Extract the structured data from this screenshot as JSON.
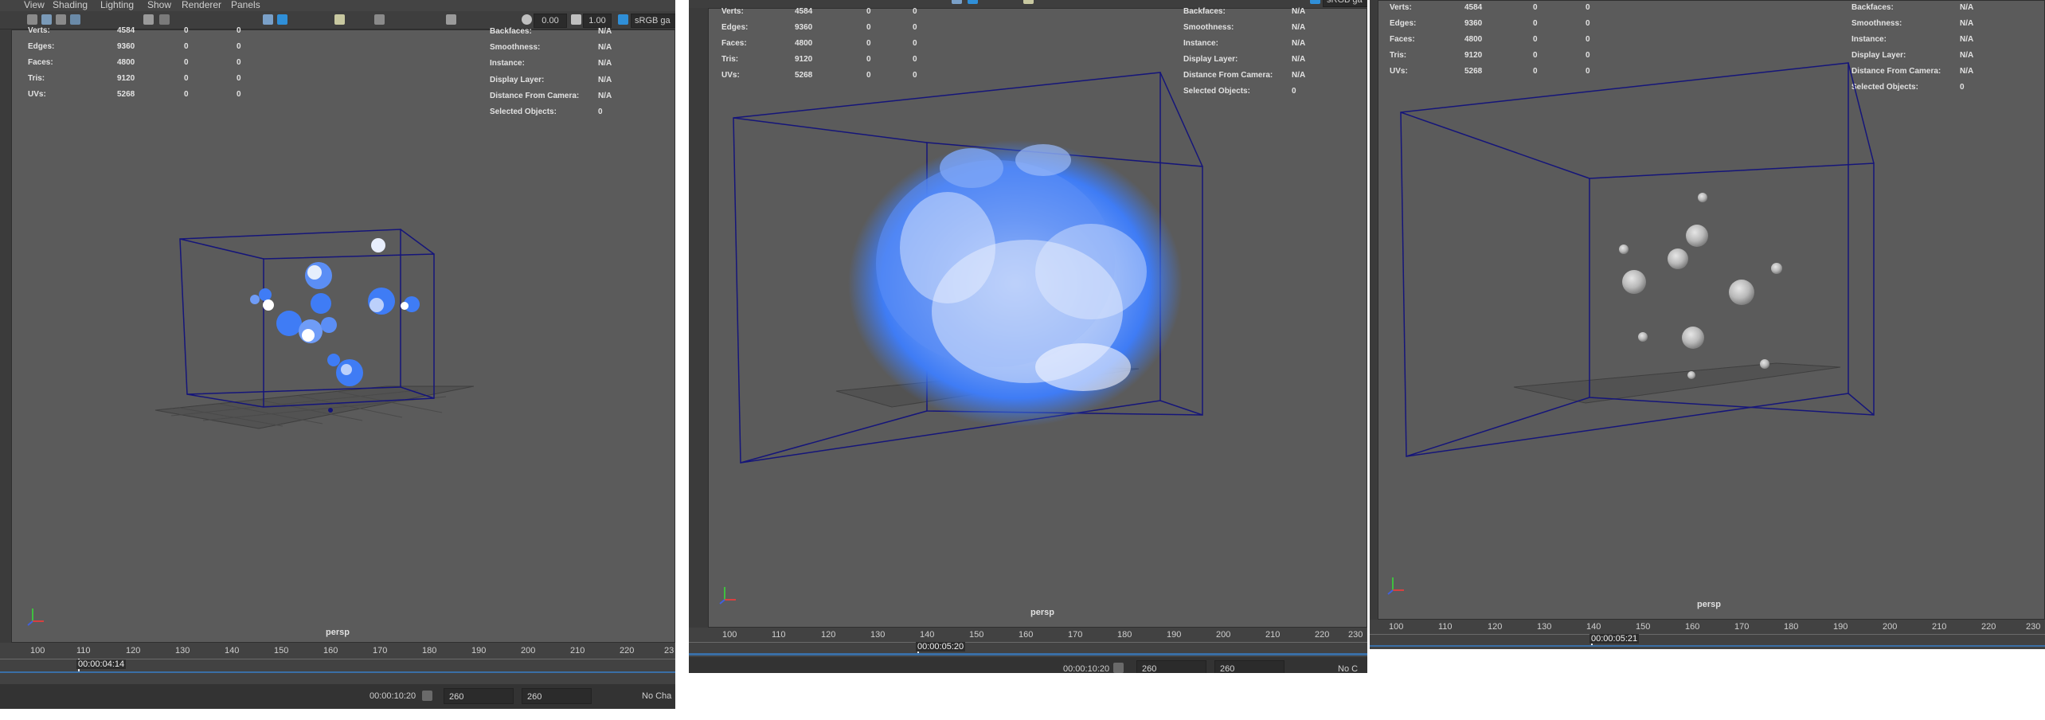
{
  "menubar": {
    "items": [
      "View",
      "Shading",
      "Lighting",
      "Show",
      "Renderer",
      "Panels"
    ]
  },
  "toolbar": {
    "field_a": "0.00",
    "field_b": "1.00",
    "color_space": "sRGB ga",
    "color_space_mid": "sRGB ga"
  },
  "hud_left_labels": [
    "Verts:",
    "Edges:",
    "Faces:",
    "Tris:",
    "UVs:"
  ],
  "hud_left_values": [
    [
      "4584",
      "0",
      "0"
    ],
    [
      "9360",
      "0",
      "0"
    ],
    [
      "4800",
      "0",
      "0"
    ],
    [
      "9120",
      "0",
      "0"
    ],
    [
      "5268",
      "0",
      "0"
    ]
  ],
  "hud_right_labels": [
    "Backfaces:",
    "Smoothness:",
    "Instance:",
    "Display Layer:",
    "Distance From Camera:",
    "Selected Objects:"
  ],
  "hud_right_values": [
    "N/A",
    "N/A",
    "N/A",
    "N/A",
    "N/A",
    "0"
  ],
  "camera_label": "persp",
  "timeline": {
    "ticks_p1": [
      "100",
      "110",
      "120",
      "130",
      "140",
      "150",
      "160",
      "170",
      "180",
      "190",
      "200",
      "210",
      "220",
      "23"
    ],
    "ticks_p2": [
      "100",
      "110",
      "120",
      "130",
      "140",
      "150",
      "160",
      "170",
      "180",
      "190",
      "200",
      "210",
      "220",
      "230"
    ],
    "ticks_p3": [
      "100",
      "110",
      "120",
      "130",
      "140",
      "150",
      "160",
      "170",
      "180",
      "190",
      "200",
      "210",
      "220",
      "230"
    ],
    "timecode_p1": "00:00:04:14",
    "timecode_p2": "00:00:05:20",
    "timecode_p3": "00:00:05:21"
  },
  "rangebar": {
    "end_time": "00:00:10:20",
    "range_start": "260",
    "range_end": "260",
    "char_set_p1": "No Cha",
    "char_set_p2": "No C"
  },
  "colors": {
    "viewport_bg": "#5b5b5b",
    "bounding_box": "#15157a",
    "fluid_blue": "#3f7cf5",
    "sphere_gray": "#b9b9b9",
    "highlight_blue": "#2f8fd8"
  }
}
